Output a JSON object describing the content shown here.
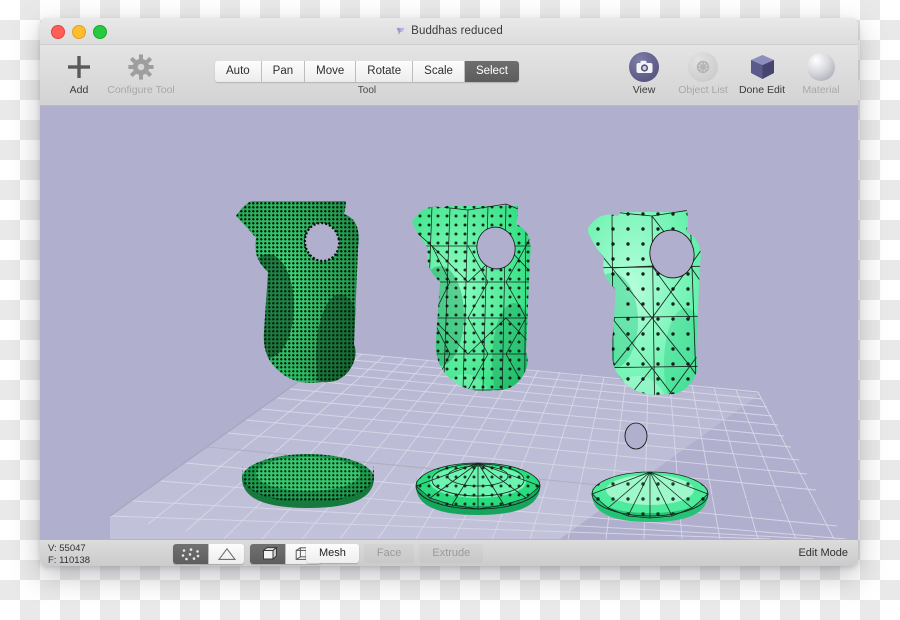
{
  "window": {
    "title": "Buddhas reduced",
    "title_icon": "app-mark-icon",
    "traffic_lights": [
      {
        "name": "close-button",
        "color": "#ff5f57"
      },
      {
        "name": "minimize-button",
        "color": "#ffbd2e"
      },
      {
        "name": "zoom-button",
        "color": "#28c840"
      }
    ]
  },
  "toolbar": {
    "left_items": [
      {
        "label": "Add",
        "icon": "plus-icon",
        "enabled": true
      },
      {
        "label": "Configure Tool",
        "icon": "gear-icon",
        "enabled": false
      }
    ],
    "tool_group": {
      "caption": "Tool",
      "options": [
        "Auto",
        "Pan",
        "Move",
        "Rotate",
        "Scale",
        "Select"
      ],
      "selected": "Select"
    },
    "right_items": [
      {
        "label": "View",
        "icon": "camera-icon",
        "enabled": true
      },
      {
        "label": "Object List",
        "icon": "object-list-icon",
        "enabled": false
      },
      {
        "label": "Done Edit",
        "icon": "cube-icon",
        "enabled": true
      },
      {
        "label": "Material",
        "icon": "sphere-icon",
        "enabled": false
      }
    ]
  },
  "viewport": {
    "background_color": "#b0b0ce",
    "grid_color": "#cdcde0",
    "light_gizmo": {
      "name": "sun-light-gizmo-icon",
      "color": "#f7eccd"
    },
    "objects": [
      {
        "name": "buddha-statue-high-poly",
        "detail": "dense point cloud",
        "color": "#2fbf5f"
      },
      {
        "name": "buddha-statue-mid-poly",
        "detail": "medium wireframe",
        "color": "#3fe08a"
      },
      {
        "name": "buddha-statue-low-poly",
        "detail": "coarse wireframe",
        "color": "#5ef0a5"
      }
    ]
  },
  "statusbar": {
    "vertex_count": "V: 55047",
    "face_count": "F: 110138",
    "display_segments": [
      {
        "name": "points-display-toggle",
        "icon": "points-icon",
        "active": true
      },
      {
        "name": "triangles-display-toggle",
        "icon": "triangle-icon",
        "active": false
      }
    ],
    "shading_segments": [
      {
        "name": "solid-shading-toggle",
        "icon": "solid-cube-icon",
        "active": true
      },
      {
        "name": "wireframe-shading-toggle",
        "icon": "wireframe-cube-icon",
        "active": false
      }
    ],
    "mode_buttons": [
      {
        "label": "Mesh",
        "enabled": true
      },
      {
        "label": "Face",
        "enabled": false
      },
      {
        "label": "Extrude",
        "enabled": false
      }
    ],
    "mode_label": "Edit Mode"
  }
}
